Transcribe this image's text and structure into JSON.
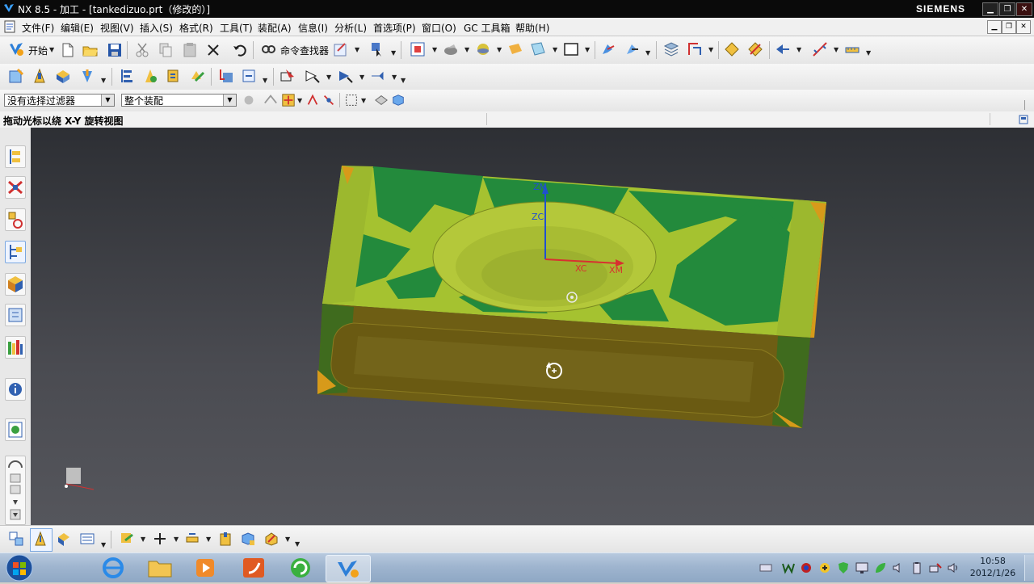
{
  "window": {
    "title": "NX 8.5 - 加工 - [tankedizuo.prt（修改的）]",
    "brand": "SIEMENS",
    "controls": {
      "minimize": "▁",
      "restore": "❐",
      "close": "✕"
    }
  },
  "menubar": {
    "items": [
      "文件(F)",
      "编辑(E)",
      "视图(V)",
      "插入(S)",
      "格式(R)",
      "工具(T)",
      "装配(A)",
      "信息(I)",
      "分析(L)",
      "首选项(P)",
      "窗口(O)",
      "GC 工具箱",
      "帮助(H)"
    ]
  },
  "toolbar1": {
    "start_label": "开始",
    "command_finder_label": "命令查找器"
  },
  "selection_bar": {
    "filter_value": "没有选择过滤器",
    "scope_value": "整个装配"
  },
  "cue_line": {
    "text": "拖动光标以绕 X-Y 旋转视图"
  },
  "viewport": {
    "axis_labels": {
      "zm": "ZM",
      "zc": "ZC",
      "xc": "XC",
      "xm": "XM"
    },
    "colors": {
      "top_yellow": "#a5c230",
      "top_green": "#238a3c",
      "front_olive": "#6e5e14",
      "edge_orange": "#d79a1a"
    }
  },
  "taskbar": {
    "time": "10:58",
    "date": "2012/1/26"
  }
}
